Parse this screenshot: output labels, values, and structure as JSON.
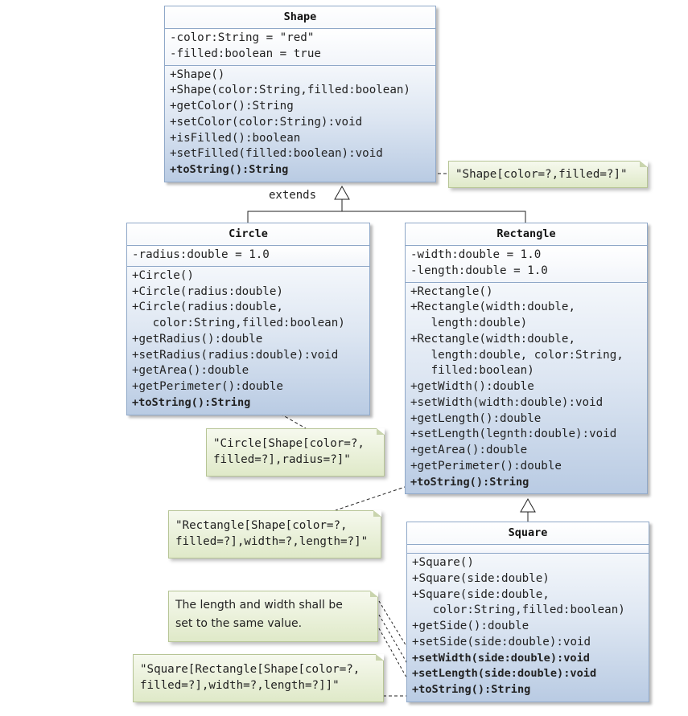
{
  "diagram": {
    "type": "UML class diagram",
    "classes": {
      "shape": {
        "name": "Shape",
        "attributes": [
          "-color:String = \"red\"",
          "-filled:boolean = true"
        ],
        "operations": [
          {
            "text": "+Shape()",
            "bold": false
          },
          {
            "text": "+Shape(color:String,filled:boolean)",
            "bold": false
          },
          {
            "text": "+getColor():String",
            "bold": false
          },
          {
            "text": "+setColor(color:String):void",
            "bold": false
          },
          {
            "text": "+isFilled():boolean",
            "bold": false
          },
          {
            "text": "+setFilled(filled:boolean):void",
            "bold": false
          },
          {
            "text": "+toString():String",
            "bold": true
          }
        ]
      },
      "circle": {
        "name": "Circle",
        "attributes": [
          "-radius:double = 1.0"
        ],
        "operations": [
          {
            "text": "+Circle()",
            "bold": false
          },
          {
            "text": "+Circle(radius:double)",
            "bold": false
          },
          {
            "text": "+Circle(radius:double,",
            "bold": false
          },
          {
            "text": "   color:String,filled:boolean)",
            "bold": false
          },
          {
            "text": "+getRadius():double",
            "bold": false
          },
          {
            "text": "+setRadius(radius:double):void",
            "bold": false
          },
          {
            "text": "+getArea():double",
            "bold": false
          },
          {
            "text": "+getPerimeter():double",
            "bold": false
          },
          {
            "text": "+toString():String",
            "bold": true
          }
        ]
      },
      "rectangle": {
        "name": "Rectangle",
        "attributes": [
          "-width:double = 1.0",
          "-length:double = 1.0"
        ],
        "operations": [
          {
            "text": "+Rectangle()",
            "bold": false
          },
          {
            "text": "+Rectangle(width:double,",
            "bold": false
          },
          {
            "text": "   length:double)",
            "bold": false
          },
          {
            "text": "+Rectangle(width:double,",
            "bold": false
          },
          {
            "text": "   length:double, color:String,",
            "bold": false
          },
          {
            "text": "   filled:boolean)",
            "bold": false
          },
          {
            "text": "+getWidth():double",
            "bold": false
          },
          {
            "text": "+setWidth(width:double):void",
            "bold": false
          },
          {
            "text": "+getLength():double",
            "bold": false
          },
          {
            "text": "+setLength(legnth:double):void",
            "bold": false
          },
          {
            "text": "+getArea():double",
            "bold": false
          },
          {
            "text": "+getPerimeter():double",
            "bold": false
          },
          {
            "text": "+toString():String",
            "bold": true
          }
        ]
      },
      "square": {
        "name": "Square",
        "attributes": [],
        "operations": [
          {
            "text": "+Square()",
            "bold": false
          },
          {
            "text": "+Square(side:double)",
            "bold": false
          },
          {
            "text": "+Square(side:double,",
            "bold": false
          },
          {
            "text": "   color:String,filled:boolean)",
            "bold": false
          },
          {
            "text": "+getSide():double",
            "bold": false
          },
          {
            "text": "+setSide(side:double):void",
            "bold": false
          },
          {
            "text": "+setWidth(side:double):void",
            "bold": true
          },
          {
            "text": "+setLength(side:double):void",
            "bold": true
          },
          {
            "text": "+toString():String",
            "bold": true
          }
        ]
      }
    },
    "relations": {
      "extends_label": "extends",
      "generalizations": [
        {
          "child": "Circle",
          "parent": "Shape"
        },
        {
          "child": "Rectangle",
          "parent": "Shape"
        },
        {
          "child": "Square",
          "parent": "Rectangle"
        }
      ]
    },
    "notes": {
      "shape_tostring": "\"Shape[color=?,filled=?]\"",
      "circle_tostring": "\"Circle[Shape[color=?,\nfilled=?],radius=?]\"",
      "rectangle_tostring": "\"Rectangle[Shape[color=?,\nfilled=?],width=?,length=?]\"",
      "square_setters": "The length and width shall be\nset to the same value.",
      "square_tostring": "\"Square[Rectangle[Shape[color=?,\nfilled=?],width=?,length=?]]\""
    }
  }
}
